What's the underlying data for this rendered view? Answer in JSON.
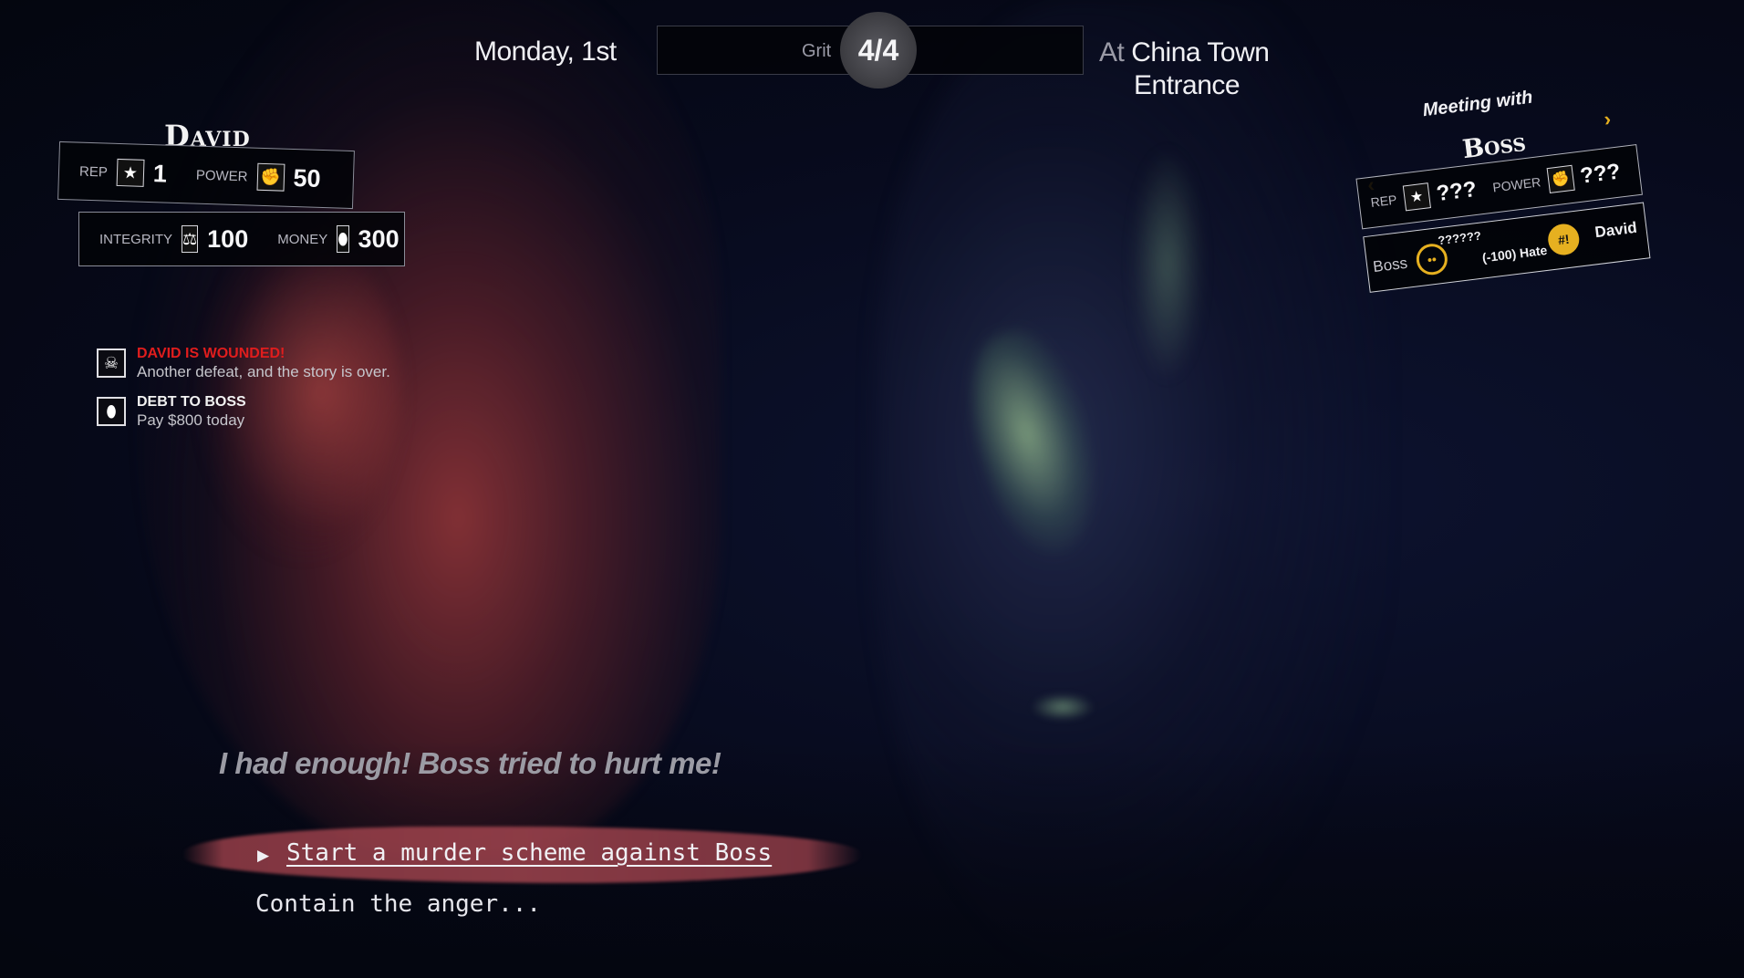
{
  "header": {
    "date": "Monday, 1st",
    "grit_label": "Grit",
    "grit_value": "4/4",
    "location_prefix": "At",
    "location_line1": "China Town",
    "location_line2": "Entrance"
  },
  "player": {
    "name": "David",
    "stats": {
      "rep_label": "REP",
      "rep_value": "1",
      "power_label": "POWER",
      "power_value": "50",
      "integrity_label": "INTEGRITY",
      "integrity_value": "100",
      "money_label": "MONEY",
      "money_value": "300"
    },
    "icons": {
      "rep": "star-icon",
      "power": "fist-icon",
      "integrity": "scales-icon",
      "money": "coin-icon"
    }
  },
  "statuses": [
    {
      "icon": "skull-icon",
      "title": "DAVID IS WOUNDED!",
      "description": "Another defeat, and the story is over.",
      "color": "#e01d1d"
    },
    {
      "icon": "coin-icon",
      "title": "DEBT TO BOSS",
      "description": "Pay $800 today",
      "color": "#f2f2f2"
    }
  ],
  "meeting": {
    "title": "Meeting with",
    "npc_name": "Boss",
    "rep_label": "REP",
    "rep_value": "???",
    "power_label": "POWER",
    "power_value": "???",
    "relation": {
      "left_name": "Boss",
      "unknown_text": "??????",
      "hate_text": "(-100) Hate",
      "right_name": "David"
    },
    "accent_color": "#e6b020"
  },
  "dialogue": {
    "line": "I had enough! Boss tried to hurt me!",
    "choices": [
      {
        "label": "Start a murder scheme against Boss",
        "selected": true
      },
      {
        "label": "Contain the anger...",
        "selected": false
      }
    ]
  }
}
